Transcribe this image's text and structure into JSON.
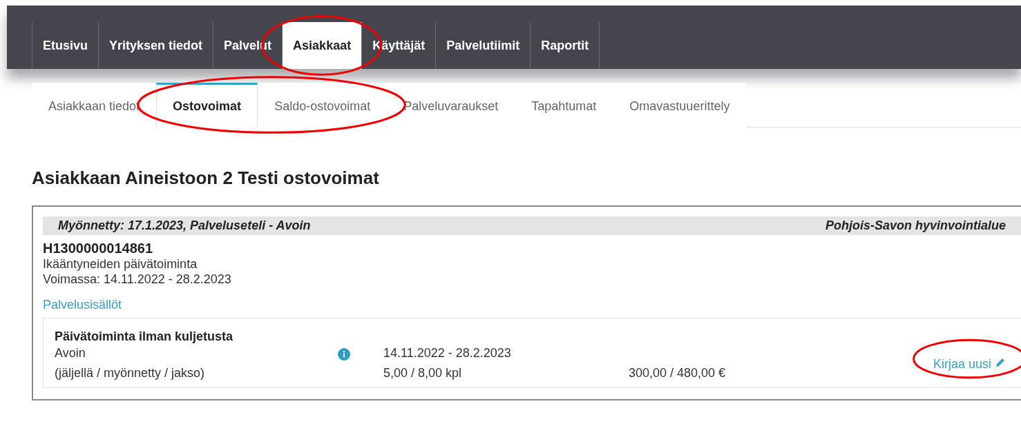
{
  "nav": [
    {
      "label": "Etusivu",
      "selected": false,
      "circled": false
    },
    {
      "label": "Yrityksen tiedot",
      "selected": false,
      "circled": false
    },
    {
      "label": "Palvelut",
      "selected": false,
      "circled": false
    },
    {
      "label": "Asiakkaat",
      "selected": true,
      "circled": true
    },
    {
      "label": "Käyttäjät",
      "selected": false,
      "circled": false
    },
    {
      "label": "Palvelutiimit",
      "selected": false,
      "circled": false
    },
    {
      "label": "Raportit",
      "selected": false,
      "circled": false
    }
  ],
  "subtabs": [
    {
      "label": "Asiakkaan tiedot",
      "selected": false,
      "circled": false
    },
    {
      "label": "Ostovoimat",
      "selected": true,
      "circled": true
    },
    {
      "label": "Saldo-ostovoimat",
      "selected": false,
      "circled": true
    },
    {
      "label": "Palveluvaraukset",
      "selected": false,
      "circled": false
    },
    {
      "label": "Tapahtumat",
      "selected": false,
      "circled": false
    },
    {
      "label": "Omavastuuerittely",
      "selected": false,
      "circled": false
    }
  ],
  "title": "Asiakkaan Aineistoon 2 Testi ostovoimat",
  "card": {
    "granted": "Myönnetty:  17.1.2023, Palveluseteli - Avoin",
    "provider": "Pohjois-Savon hyvinvointialue",
    "code": "H1300000014861",
    "service": "Ikääntyneiden päivätoiminta",
    "validity": "Voimassa:  14.11.2022 - 28.2.2023",
    "contents_link": "Palvelusisällöt",
    "item": {
      "name": "Päivätoiminta ilman kuljetusta",
      "status": "Avoin",
      "legend": "(jäljellä / myönnetty / jakso)",
      "period": "14.11.2022 - 28.2.2023",
      "quantity": "5,00 / 8,00 kpl",
      "amount": "300,00 / 480,00 €",
      "action": "Kirjaa uusi",
      "action_circled": true
    }
  }
}
